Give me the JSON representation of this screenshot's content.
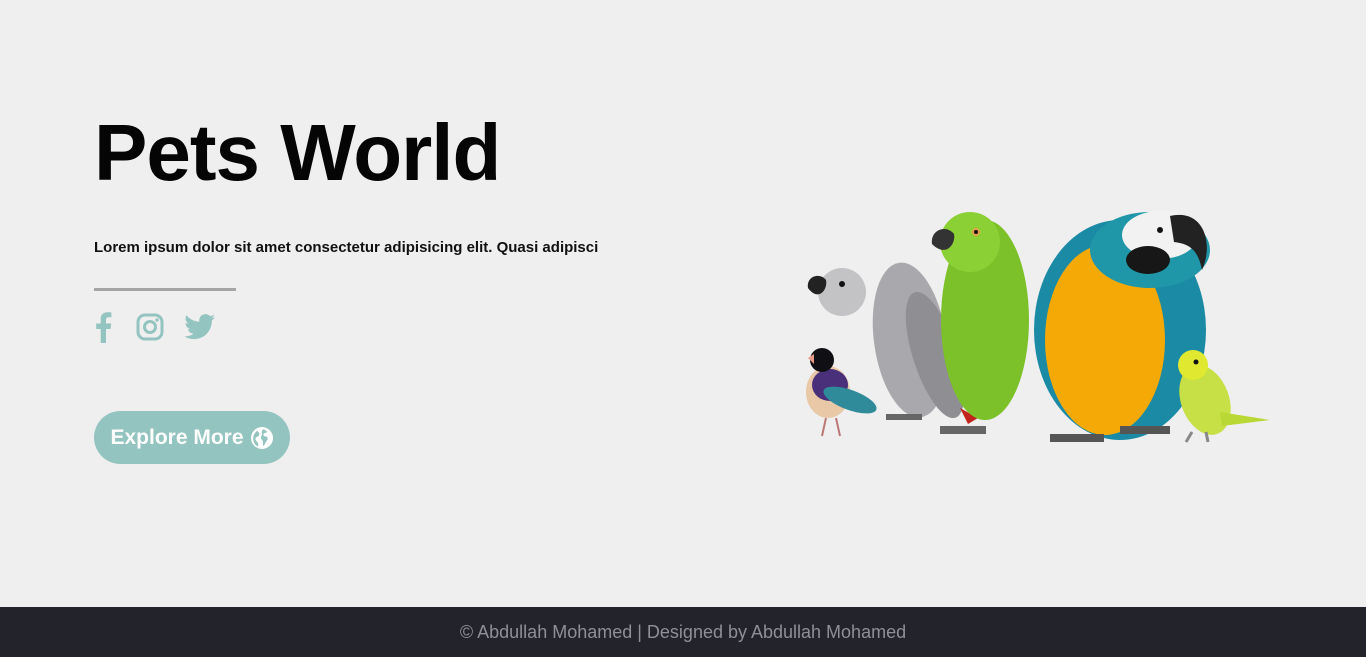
{
  "hero": {
    "title": "Pets World",
    "subtitle": "Lorem ipsum dolor sit amet consectetur adipisicing elit. Quasi adipisci"
  },
  "socials": [
    {
      "icon": "facebook-icon"
    },
    {
      "icon": "instagram-icon"
    },
    {
      "icon": "twitter-icon"
    }
  ],
  "cta": {
    "label": "Explore More",
    "icon": "globe-icon"
  },
  "image": {
    "subject": "birds-illustration"
  },
  "footer": {
    "text": "© Abdullah Mohamed | Designed by Abdullah Mohamed"
  },
  "colors": {
    "background": "#efefef",
    "accent": "#93c4bf",
    "footer_bg": "#23232b",
    "footer_text": "#8f8f96"
  }
}
